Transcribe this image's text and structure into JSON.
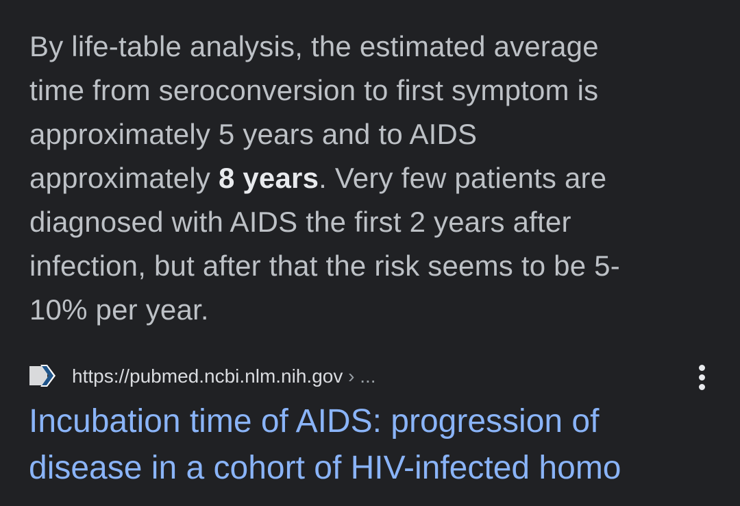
{
  "snippet": {
    "line1": "By life-table analysis, the estimated average",
    "line2": "time from seroconversion to first symptom is",
    "line3": "approximately 5 years and to AIDS",
    "line4_pre": "approximately ",
    "line4_bold": "8 years",
    "line4_post": ". Very few patients are",
    "line5": "diagnosed with AIDS the first 2 years after",
    "line6": "infection, but after that the risk seems to be 5-",
    "line7": "10% per year."
  },
  "source": {
    "favicon": "pubmed-chevron-icon",
    "url": "https://pubmed.ncbi.nlm.nih.gov",
    "separator": "›",
    "ellipsis": "...",
    "more_icon": "more-vert-icon"
  },
  "result": {
    "title_line1": "Incubation time of AIDS: progression of",
    "title_line2": "disease in a cohort of HIV-infected homo"
  },
  "colors": {
    "background": "#202124",
    "snippet_text": "#bdc1c6",
    "link": "#8ab4f8",
    "favicon_chevron": "#20558a"
  }
}
